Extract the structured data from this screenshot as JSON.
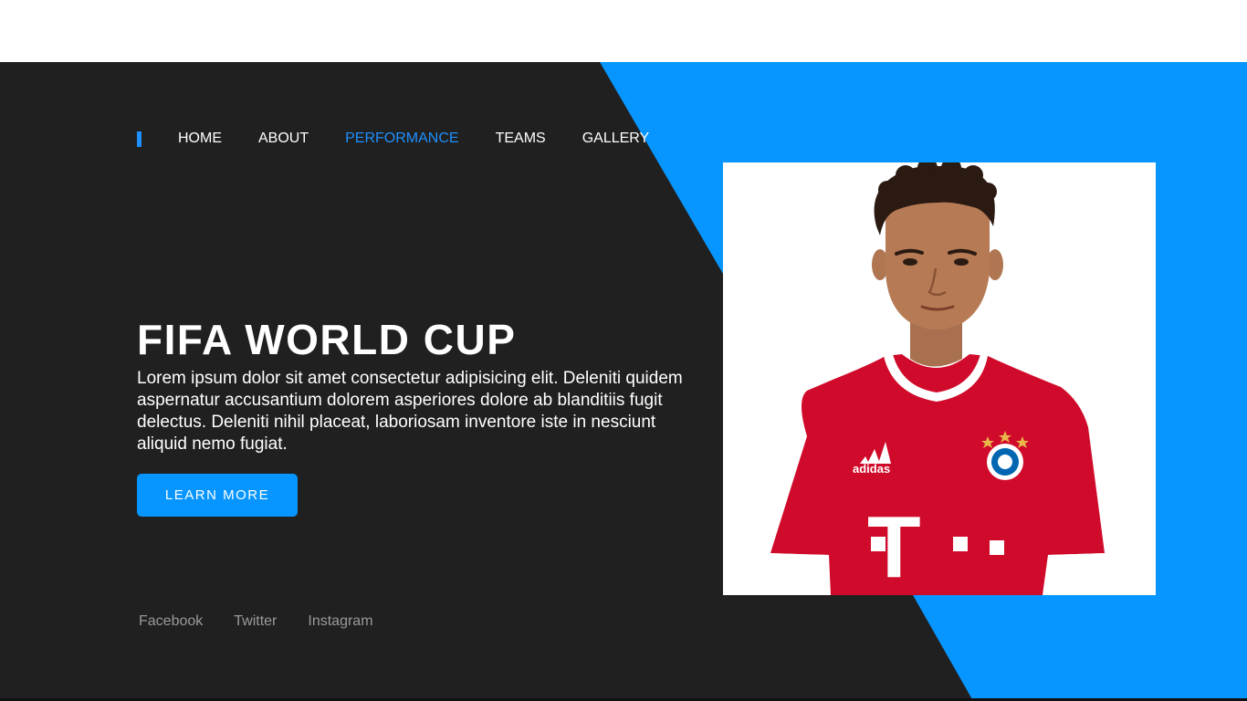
{
  "colors": {
    "dark_panel": "#202020",
    "accent_blue": "#0796ff",
    "nav_active": "#1e90ff",
    "jersey_red": "#d00a2a"
  },
  "nav": {
    "items": [
      {
        "label": "HOME",
        "active": false
      },
      {
        "label": "ABOUT",
        "active": false
      },
      {
        "label": "PERFORMANCE",
        "active": true
      },
      {
        "label": "TEAMS",
        "active": false
      },
      {
        "label": "GALLERY",
        "active": false
      }
    ]
  },
  "hero": {
    "title": "FIFA WORLD CUP",
    "description": "Lorem ipsum dolor sit amet consectetur adipisicing elit. Deleniti quidem aspernatur accusantium dolorem asperiores dolore ab blanditiis fugit delectus. Deleniti nihil placeat, laboriosam inventore iste in nesciunt aliquid nemo fugiat.",
    "cta_label": "LEARN MORE"
  },
  "social": {
    "links": [
      "Facebook",
      "Twitter",
      "Instagram"
    ]
  },
  "player_photo": {
    "brand_mark": "adidas",
    "shirt_logo": "T"
  }
}
